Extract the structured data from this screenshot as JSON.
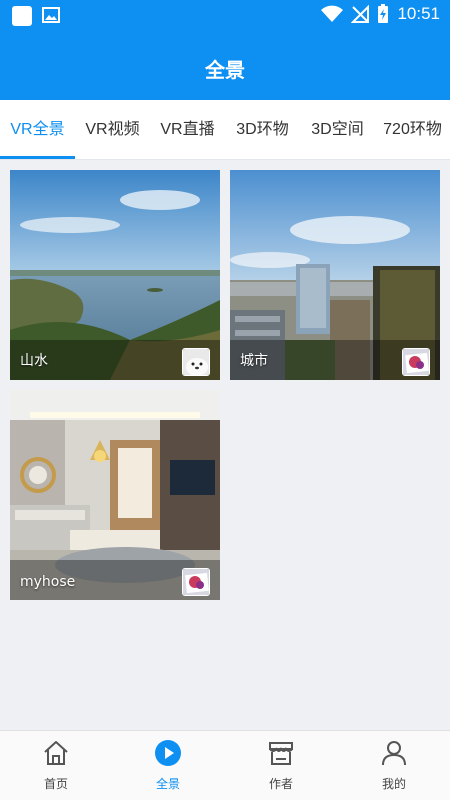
{
  "status_bar": {
    "time": "10:51"
  },
  "header": {
    "title": "全景"
  },
  "tabs": [
    {
      "label": "VR全景",
      "active": true
    },
    {
      "label": "VR视频",
      "active": false
    },
    {
      "label": "VR直播",
      "active": false
    },
    {
      "label": "3D环物",
      "active": false
    },
    {
      "label": "3D空间",
      "active": false
    },
    {
      "label": "720环物",
      "active": false
    }
  ],
  "cards": [
    {
      "label": "山水"
    },
    {
      "label": "城市"
    },
    {
      "label": "myhose"
    }
  ],
  "bottom_nav": [
    {
      "label": "首页",
      "icon": "home-icon",
      "active": false
    },
    {
      "label": "全景",
      "icon": "play-icon",
      "active": true
    },
    {
      "label": "作者",
      "icon": "store-icon",
      "active": false
    },
    {
      "label": "我的",
      "icon": "user-icon",
      "active": false
    }
  ],
  "colors": {
    "accent": "#0e8ff2",
    "background": "#eef0f4"
  }
}
